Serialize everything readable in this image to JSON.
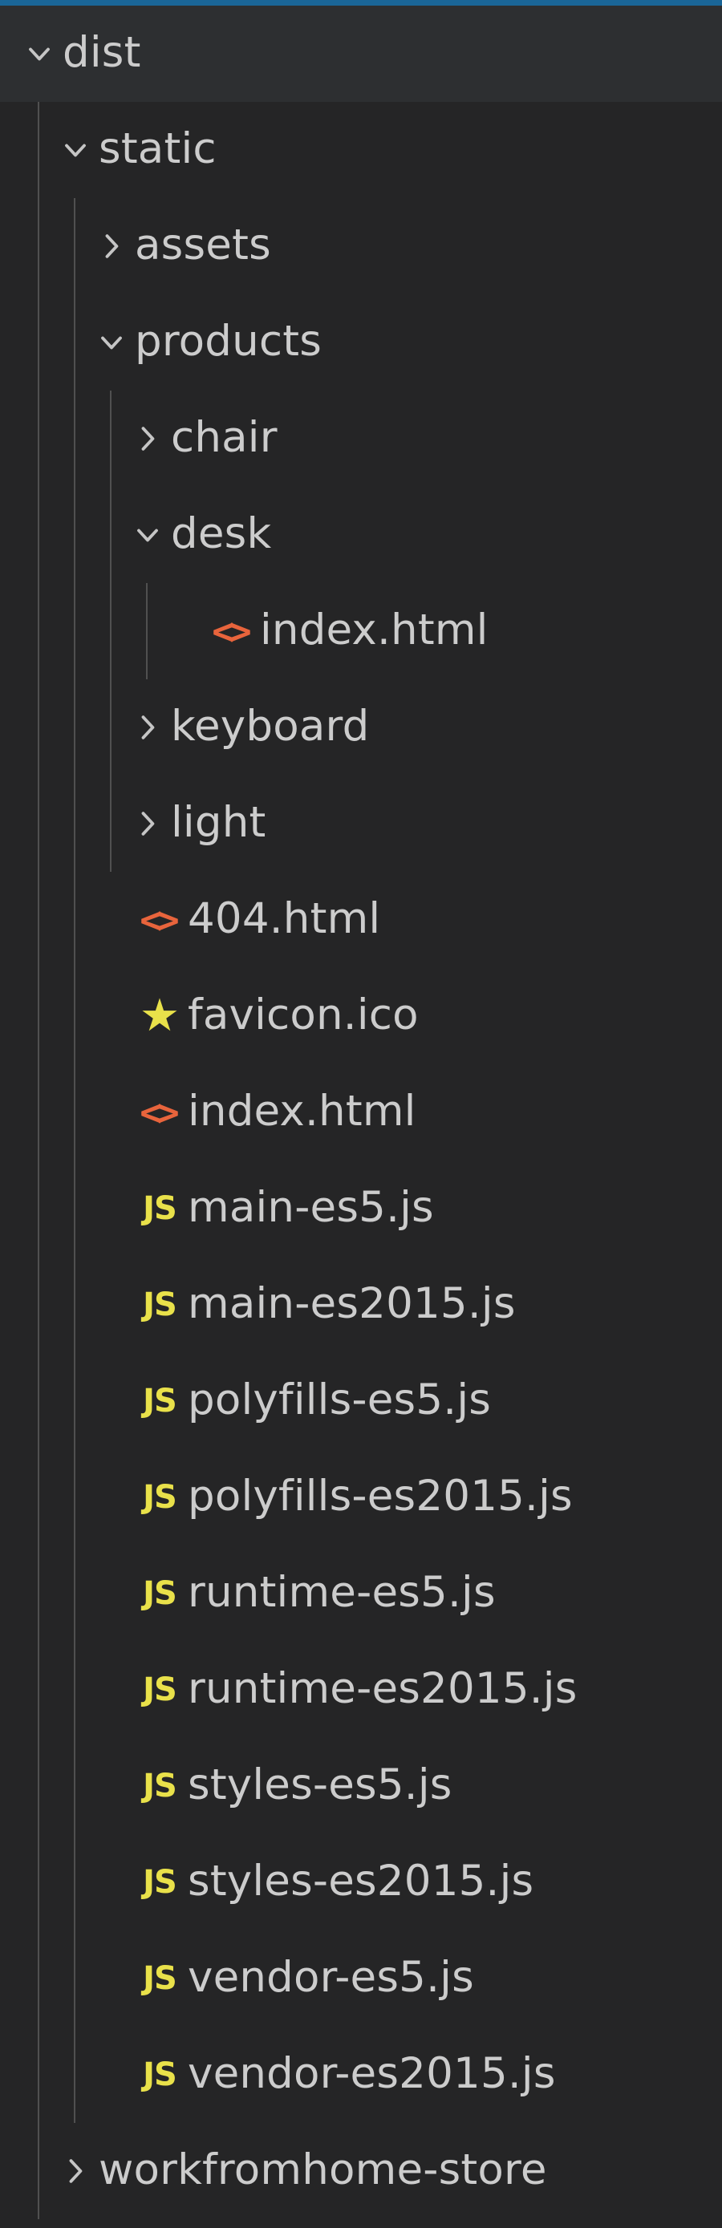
{
  "panel": {
    "name": "explorer-file-tree",
    "background_color": "#252526",
    "selected_row_color": "#2d2f31",
    "focus_border_color": "#1a6698",
    "text_color": "#cccccc",
    "indent_guide_color": "#585858",
    "html_icon_color": "#e8643c",
    "js_icon_color": "#e9e14a",
    "star_icon_color": "#e9e14a"
  },
  "icons": {
    "chevron_down": "chevron-down-icon",
    "chevron_right": "chevron-right-icon",
    "html": "html-file-icon",
    "js": "js-file-icon",
    "star": "star-file-icon"
  },
  "tree": {
    "rows": [
      {
        "label": "dist",
        "depth": 0,
        "type": "folder",
        "state": "expanded",
        "icon": "none",
        "selected": true
      },
      {
        "label": "static",
        "depth": 1,
        "type": "folder",
        "state": "expanded",
        "icon": "none",
        "selected": false
      },
      {
        "label": "assets",
        "depth": 2,
        "type": "folder",
        "state": "collapsed",
        "icon": "none",
        "selected": false
      },
      {
        "label": "products",
        "depth": 2,
        "type": "folder",
        "state": "expanded",
        "icon": "none",
        "selected": false
      },
      {
        "label": "chair",
        "depth": 3,
        "type": "folder",
        "state": "collapsed",
        "icon": "none",
        "selected": false
      },
      {
        "label": "desk",
        "depth": 3,
        "type": "folder",
        "state": "expanded",
        "icon": "none",
        "selected": false
      },
      {
        "label": "index.html",
        "depth": 4,
        "type": "file",
        "state": "none",
        "icon": "html",
        "selected": false
      },
      {
        "label": "keyboard",
        "depth": 3,
        "type": "folder",
        "state": "collapsed",
        "icon": "none",
        "selected": false
      },
      {
        "label": "light",
        "depth": 3,
        "type": "folder",
        "state": "collapsed",
        "icon": "none",
        "selected": false
      },
      {
        "label": "404.html",
        "depth": 2,
        "type": "file",
        "state": "none",
        "icon": "html",
        "selected": false
      },
      {
        "label": "favicon.ico",
        "depth": 2,
        "type": "file",
        "state": "none",
        "icon": "star",
        "selected": false
      },
      {
        "label": "index.html",
        "depth": 2,
        "type": "file",
        "state": "none",
        "icon": "html",
        "selected": false
      },
      {
        "label": "main-es5.js",
        "depth": 2,
        "type": "file",
        "state": "none",
        "icon": "js",
        "selected": false
      },
      {
        "label": "main-es2015.js",
        "depth": 2,
        "type": "file",
        "state": "none",
        "icon": "js",
        "selected": false
      },
      {
        "label": "polyfills-es5.js",
        "depth": 2,
        "type": "file",
        "state": "none",
        "icon": "js",
        "selected": false
      },
      {
        "label": "polyfills-es2015.js",
        "depth": 2,
        "type": "file",
        "state": "none",
        "icon": "js",
        "selected": false
      },
      {
        "label": "runtime-es5.js",
        "depth": 2,
        "type": "file",
        "state": "none",
        "icon": "js",
        "selected": false
      },
      {
        "label": "runtime-es2015.js",
        "depth": 2,
        "type": "file",
        "state": "none",
        "icon": "js",
        "selected": false
      },
      {
        "label": "styles-es5.js",
        "depth": 2,
        "type": "file",
        "state": "none",
        "icon": "js",
        "selected": false
      },
      {
        "label": "styles-es2015.js",
        "depth": 2,
        "type": "file",
        "state": "none",
        "icon": "js",
        "selected": false
      },
      {
        "label": "vendor-es5.js",
        "depth": 2,
        "type": "file",
        "state": "none",
        "icon": "js",
        "selected": false
      },
      {
        "label": "vendor-es2015.js",
        "depth": 2,
        "type": "file",
        "state": "none",
        "icon": "js",
        "selected": false
      },
      {
        "label": "workfromhome-store",
        "depth": 1,
        "type": "folder",
        "state": "collapsed",
        "icon": "none",
        "selected": false
      }
    ]
  }
}
